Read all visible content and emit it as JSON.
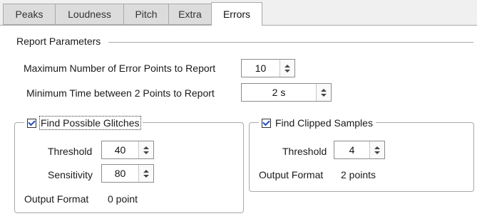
{
  "tabs": [
    "Peaks",
    "Loudness",
    "Pitch",
    "Extra",
    "Errors"
  ],
  "active_tab": "Errors",
  "report": {
    "title": "Report Parameters",
    "max_points_label": "Maximum Number of Error Points to Report",
    "max_points_value": "10",
    "min_time_label": "Minimum Time between 2 Points to Report",
    "min_time_value": "2 s"
  },
  "glitches": {
    "title": "Find Possible Glitches",
    "checked": true,
    "threshold_label": "Threshold",
    "threshold_value": "40",
    "sensitivity_label": "Sensitivity",
    "sensitivity_value": "80",
    "output_label": "Output Format",
    "output_value": "0 point"
  },
  "clipped": {
    "title": "Find Clipped Samples",
    "checked": true,
    "threshold_label": "Threshold",
    "threshold_value": "4",
    "output_label": "Output Format",
    "output_value": "2 points"
  }
}
